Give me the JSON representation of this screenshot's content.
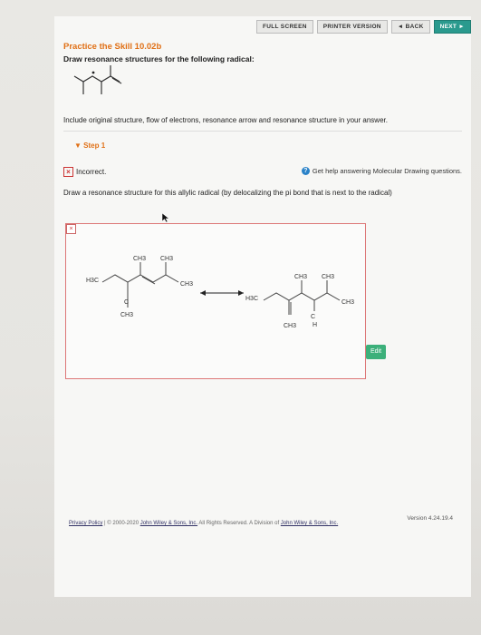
{
  "toolbar": {
    "full_screen": "FULL SCREEN",
    "printer_version": "PRINTER VERSION",
    "back": "◄ BACK",
    "next": "NEXT ►"
  },
  "question": {
    "title": "Practice the Skill 10.02b",
    "subtitle": "Draw resonance structures for the following radical:",
    "instruction": "Include original structure, flow of electrons, resonance arrow and resonance structure in your answer."
  },
  "step": {
    "label": "Step 1",
    "status": "Incorrect.",
    "help": "Get help answering Molecular Drawing questions.",
    "prompt": "Draw a resonance structure for this allylic radical (by delocalizing the pi bond that is next to the radical)"
  },
  "answer_labels": {
    "left": {
      "ch3_a": "CH3",
      "ch3_b": "CH3",
      "ch3_c": "CH3",
      "h3c": "H3C",
      "c": "C",
      "ch3_bottom": "CH3"
    },
    "right": {
      "ch3_a": "CH3",
      "ch3_b": "CH3",
      "ch3_c": "CH3",
      "h3c": "H3C",
      "c": "C",
      "h": "H",
      "ch3_bottom": "CH3"
    }
  },
  "edit_label": "Edit",
  "version": "Version 4.24.19.4",
  "footer": {
    "privacy": "Privacy Policy",
    "sep": " | ",
    "copyright_pre": "© 2000-2020 ",
    "company": "John Wiley & Sons, Inc.",
    "rights": " All Rights Reserved. A Division of ",
    "company2": "John Wiley & Sons, Inc."
  }
}
